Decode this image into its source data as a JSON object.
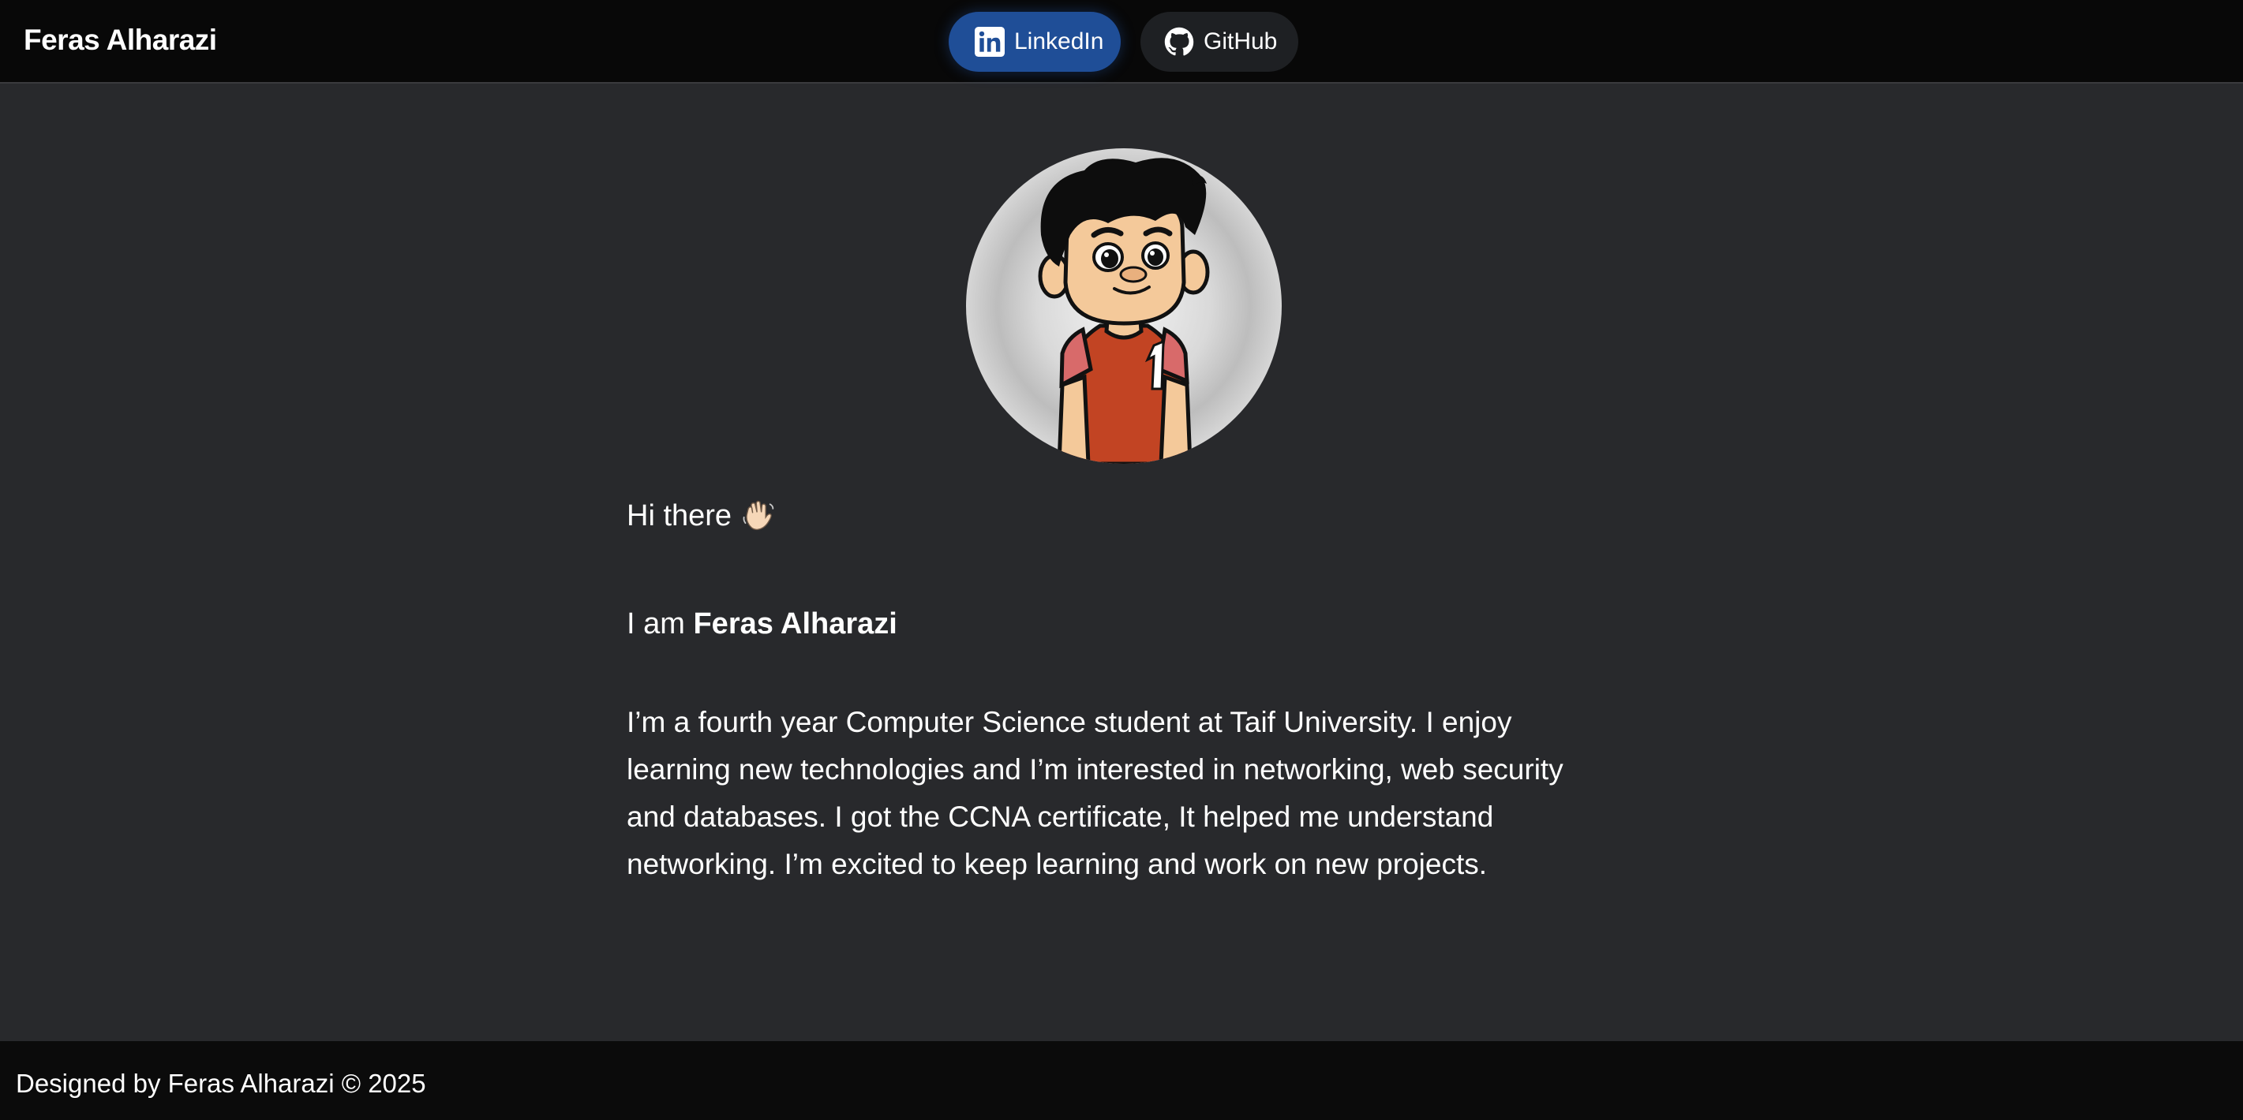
{
  "header": {
    "brand": "Feras Alharazi",
    "nav": {
      "linkedin": {
        "label": "LinkedIn",
        "icon": "linkedin-icon"
      },
      "github": {
        "label": "GitHub",
        "icon": "github-icon"
      }
    }
  },
  "profile": {
    "avatar_icon": "cartoon-avatar",
    "greeting": "Hi there",
    "wave_icon": "waving-hand-icon",
    "intro_prefix": "I am ",
    "intro_name": "Feras Alharazi",
    "bio": "I’m a fourth year Computer Science student at Taif University. I enjoy learning new technologies and I’m interested in networking, web security and databases. I got the CCNA certificate, It helped me understand networking. I’m excited to keep learning and work on new projects."
  },
  "footer": {
    "text": "Designed by Feras Alharazi © 2025"
  },
  "colors": {
    "page_bg": "#28292c",
    "header_bg": "#080808",
    "footer_bg": "#0b0b0b",
    "linkedin_bg": "#1f4e97",
    "github_bg": "#1e2023"
  }
}
